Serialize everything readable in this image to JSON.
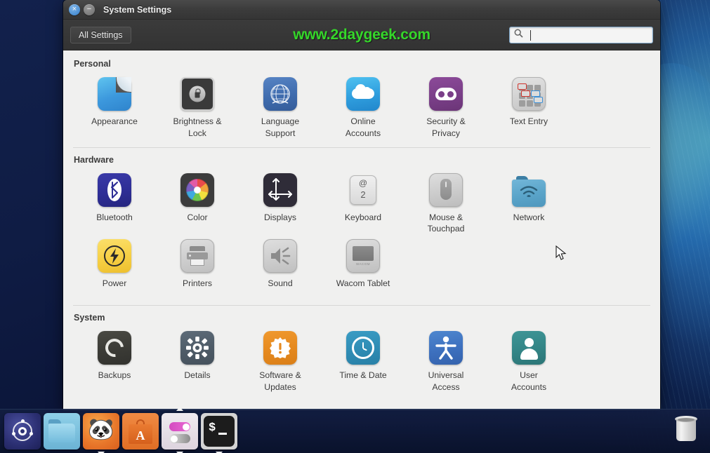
{
  "window": {
    "title": "System Settings",
    "close_label": "×",
    "minimize_label": "−"
  },
  "toolbar": {
    "all_settings_label": "All Settings",
    "watermark": "www.2daygeek.com",
    "search_value": "",
    "search_placeholder": ""
  },
  "sections": [
    {
      "title": "Personal",
      "items": [
        {
          "label": "Appearance",
          "icon": "appearance-icon"
        },
        {
          "label": "Brightness &\nLock",
          "icon": "brightness-lock-icon"
        },
        {
          "label": "Language\nSupport",
          "icon": "language-support-icon"
        },
        {
          "label": "Online\nAccounts",
          "icon": "online-accounts-icon"
        },
        {
          "label": "Security &\nPrivacy",
          "icon": "security-privacy-icon"
        },
        {
          "label": "Text Entry",
          "icon": "text-entry-icon"
        }
      ]
    },
    {
      "title": "Hardware",
      "items": [
        {
          "label": "Bluetooth",
          "icon": "bluetooth-icon"
        },
        {
          "label": "Color",
          "icon": "color-icon"
        },
        {
          "label": "Displays",
          "icon": "displays-icon"
        },
        {
          "label": "Keyboard",
          "icon": "keyboard-icon"
        },
        {
          "label": "Mouse &\nTouchpad",
          "icon": "mouse-touchpad-icon"
        },
        {
          "label": "Network",
          "icon": "network-icon"
        },
        {
          "label": "Power",
          "icon": "power-icon"
        },
        {
          "label": "Printers",
          "icon": "printers-icon"
        },
        {
          "label": "Sound",
          "icon": "sound-icon"
        },
        {
          "label": "Wacom Tablet",
          "icon": "wacom-tablet-icon"
        }
      ]
    },
    {
      "title": "System",
      "items": [
        {
          "label": "Backups",
          "icon": "backups-icon"
        },
        {
          "label": "Details",
          "icon": "details-icon"
        },
        {
          "label": "Software &\nUpdates",
          "icon": "software-updates-icon"
        },
        {
          "label": "Time & Date",
          "icon": "time-date-icon"
        },
        {
          "label": "Universal\nAccess",
          "icon": "universal-access-icon"
        },
        {
          "label": "User\nAccounts",
          "icon": "user-accounts-icon"
        }
      ]
    }
  ],
  "keyboard_icon": {
    "top_char": "@",
    "bottom_char": "2"
  },
  "wacom_icon": {
    "brand": "WACOM"
  },
  "terminal_icon": {
    "prompt": "$"
  },
  "software_center_icon": {
    "letter": "A"
  },
  "launcher": {
    "items": [
      {
        "name": "ubuntu-dash",
        "tooltip": "Dash",
        "running": false
      },
      {
        "name": "files",
        "tooltip": "Files",
        "running": false
      },
      {
        "name": "firefox",
        "tooltip": "Firefox Web Browser",
        "running": true
      },
      {
        "name": "software-center",
        "tooltip": "Ubuntu Software Center",
        "running": false
      },
      {
        "name": "system-settings",
        "tooltip": "System Settings",
        "running": true
      },
      {
        "name": "terminal",
        "tooltip": "Terminal",
        "running": true
      }
    ],
    "trash_tooltip": "Trash"
  },
  "colors": {
    "watermark_green": "#35d72a",
    "titlebar": "#3c3c3c",
    "content_bg": "#f0f0ef",
    "accent_orange": "#e5891f",
    "desktop_blue": "#12214c"
  }
}
